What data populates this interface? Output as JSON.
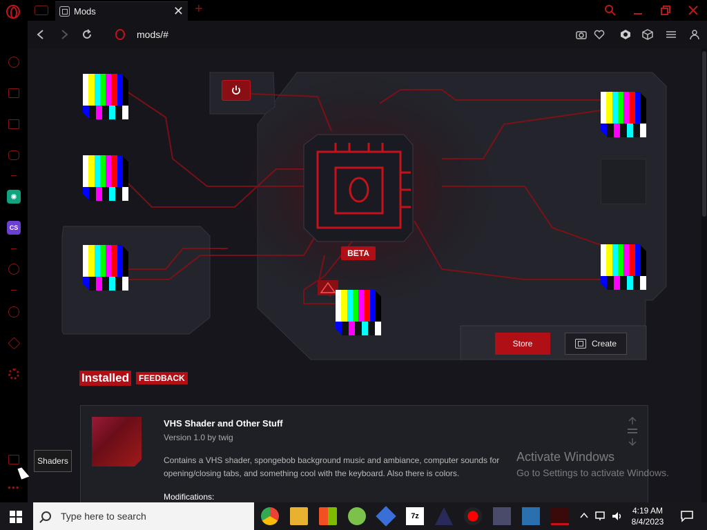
{
  "tab": {
    "title": "Mods",
    "close_glyph": "✕",
    "add_glyph": "+"
  },
  "address": {
    "url": "mods/#"
  },
  "mods_page": {
    "beta_label": "BETA",
    "store_label": "Store",
    "create_label": "Create",
    "installed_label": "Installed",
    "feedback_label": "FEEDBACK"
  },
  "installed_mods": [
    {
      "name": "VHS Shader and Other Stuff",
      "version_line": "Version 1.0 by twig",
      "description": "Contains a VHS shader, spongebob background music and ambiance, computer sounds for opening/closing tabs, and something cool with the keyboard. Also there is colors.",
      "modifications_label": "Modifications:"
    }
  ],
  "tooltip": {
    "text": "Shaders"
  },
  "watermark": {
    "title": "Activate Windows",
    "subtitle": "Go to Settings to activate Windows."
  },
  "taskbar": {
    "search_placeholder": "Type here to search",
    "time": "4:19 AM",
    "date": "8/4/2023"
  },
  "sidebar_badges": {
    "gpt": "✺",
    "cs": "CS"
  },
  "colors": {
    "accent": "#b10f16",
    "sidebar_icon": "#8a1414",
    "page_bg": "#16161c",
    "panel_bg": "#24242c"
  },
  "icons": [
    "opera-logo",
    "back-icon",
    "forward-icon",
    "reload-icon",
    "camera-icon",
    "heart-icon",
    "vpn-icon",
    "cube-icon",
    "settings-icon",
    "account-icon"
  ]
}
